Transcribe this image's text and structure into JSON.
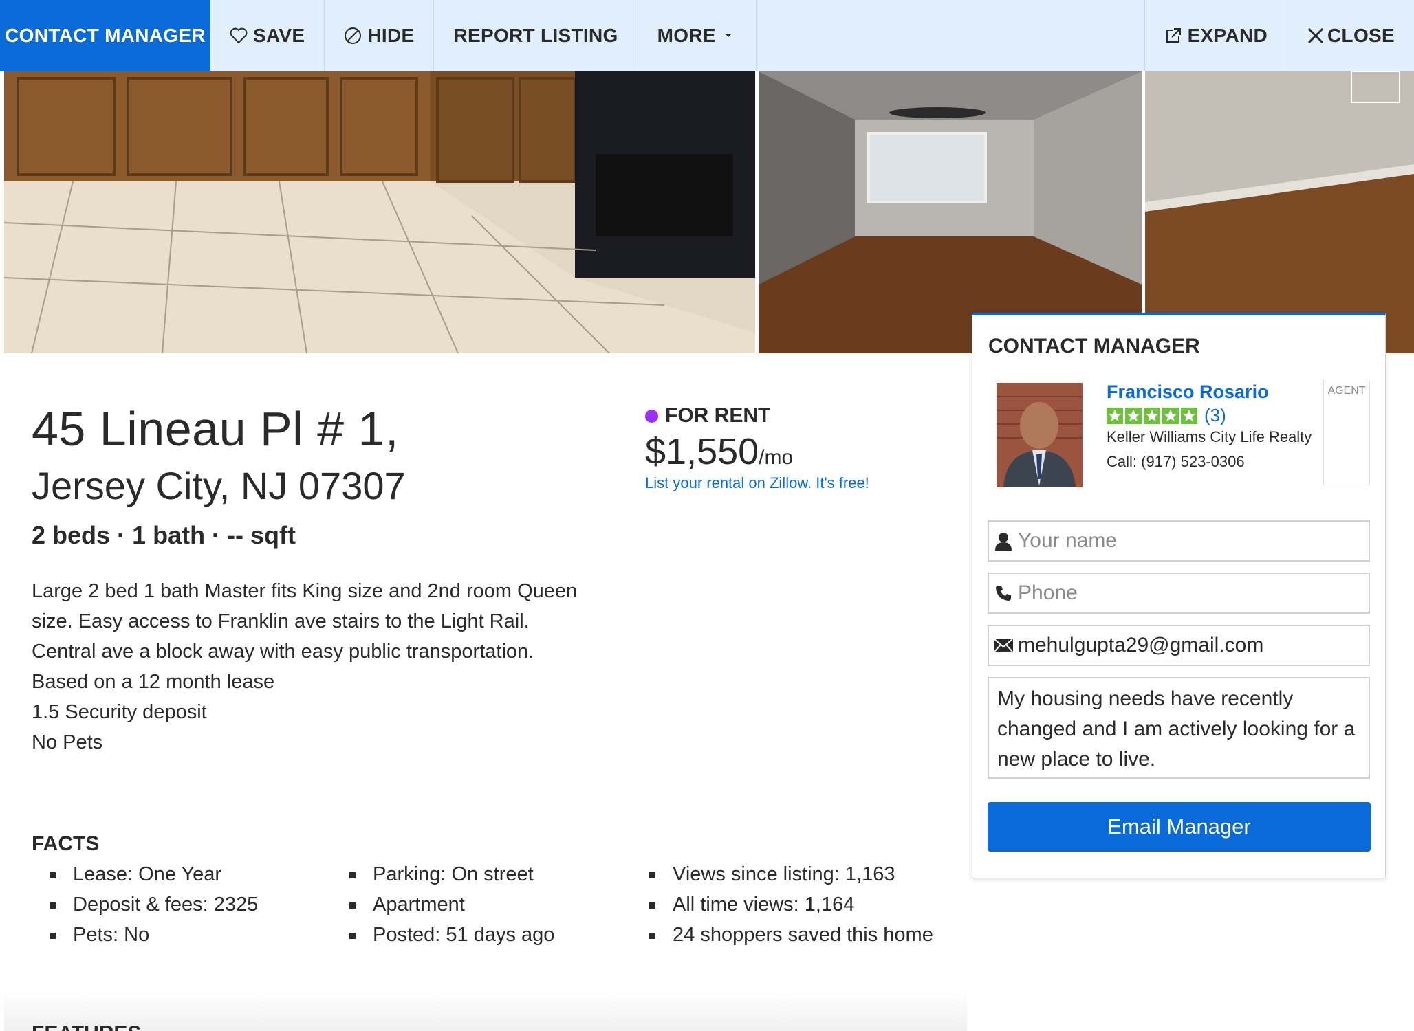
{
  "toolbar": {
    "contact": "CONTACT MANAGER",
    "save": "SAVE",
    "hide": "HIDE",
    "report": "REPORT LISTING",
    "more": "MORE",
    "expand": "EXPAND",
    "close": "CLOSE"
  },
  "listing": {
    "address_line1": "45 Lineau Pl # 1,",
    "address_line2": "Jersey City, NJ 07307",
    "specs": "2 beds · 1 bath · -- sqft",
    "status": "FOR RENT",
    "status_color": "#9b30f5",
    "price": "$1,550",
    "price_unit": "/mo",
    "promo": "List your rental on Zillow. It's free!",
    "description": [
      "Large 2 bed 1 bath Master fits King size and 2nd room Queen size. Easy access to Franklin ave stairs to the Light Rail. Central ave a block away with easy public transportation.",
      "Based on a 12 month lease",
      "1.5 Security deposit",
      "No Pets"
    ]
  },
  "facts": {
    "title": "FACTS",
    "col1": [
      "Lease: One Year",
      "Deposit & fees: 2325",
      "Pets: No"
    ],
    "col2": [
      "Parking: On street",
      "Apartment",
      "Posted: 51 days ago"
    ],
    "col3": [
      "Views since listing: 1,163",
      "All time views: 1,164",
      "24 shoppers saved this home"
    ]
  },
  "features_title": "FEATURES",
  "contact_card": {
    "title": "CONTACT MANAGER",
    "agent_name": "Francisco Rosario",
    "rating_stars": 5,
    "review_count": "(3)",
    "agency": "Keller Williams City Life Realty",
    "phone": "Call: (917) 523-0306",
    "badge": "AGENT",
    "name_placeholder": "Your name",
    "phone_placeholder": "Phone",
    "email_value": "mehulgupta29@gmail.com",
    "message": "My housing needs have recently changed and I am actively looking for a new place to live.",
    "button": "Email Manager"
  },
  "colors": {
    "accent": "#0a6bd8",
    "toolbar_bg": "#e1eefc",
    "star": "#6cc23a"
  }
}
